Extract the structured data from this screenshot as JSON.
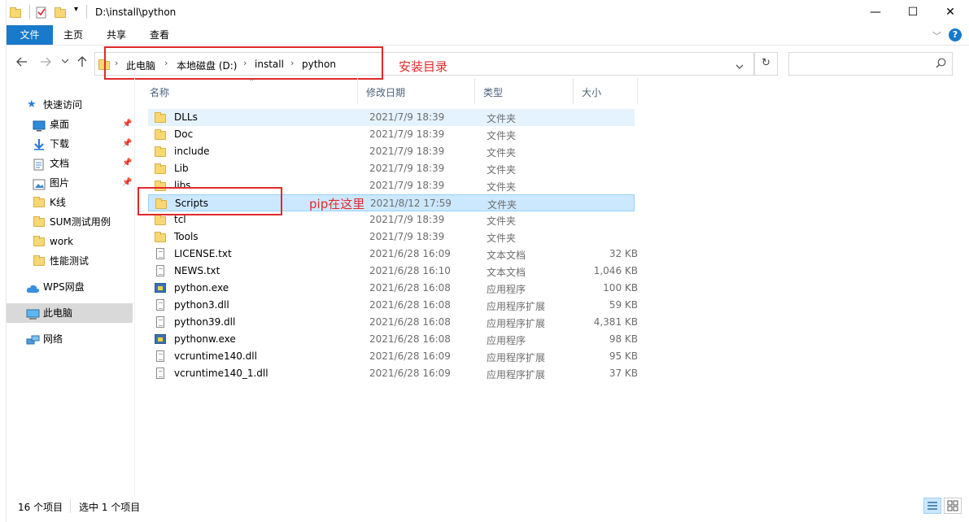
{
  "window": {
    "title": "D:\\install\\python"
  },
  "ribbon": {
    "tabs": [
      "文件",
      "主页",
      "共享",
      "查看"
    ]
  },
  "nav": {
    "back_icon": "arrow-left-icon",
    "forward_icon": "arrow-right-icon",
    "recent_icon": "chevron-down-icon",
    "up_icon": "arrow-up-icon"
  },
  "address": {
    "crumbs": [
      "此电脑",
      "本地磁盘 (D:)",
      "install",
      "python"
    ]
  },
  "annotations": {
    "address_note": "安装目录",
    "scripts_note": "pip在这里",
    "color": "#e02a2a"
  },
  "sidebar": {
    "items": [
      {
        "label": "快速访问",
        "icon": "star-icon"
      },
      {
        "label": "桌面",
        "icon": "desktop-icon",
        "pinned": true
      },
      {
        "label": "下载",
        "icon": "download-icon",
        "pinned": true
      },
      {
        "label": "文档",
        "icon": "document-icon",
        "pinned": true
      },
      {
        "label": "图片",
        "icon": "picture-icon",
        "pinned": true
      },
      {
        "label": "K线",
        "icon": "folder-icon"
      },
      {
        "label": "SUM测试用例",
        "icon": "folder-icon"
      },
      {
        "label": "work",
        "icon": "folder-icon"
      },
      {
        "label": "性能测试",
        "icon": "folder-icon"
      },
      {
        "label": "WPS网盘",
        "icon": "cloud-icon"
      },
      {
        "label": "此电脑",
        "icon": "computer-icon"
      },
      {
        "label": "网络",
        "icon": "network-icon"
      }
    ]
  },
  "columns": {
    "name": "名称",
    "modified": "修改日期",
    "type": "类型",
    "size": "大小"
  },
  "files": [
    {
      "name": "DLLs",
      "modified": "2021/7/9 18:39",
      "type": "文件夹",
      "size": "",
      "icon": "folder-icon"
    },
    {
      "name": "Doc",
      "modified": "2021/7/9 18:39",
      "type": "文件夹",
      "size": "",
      "icon": "folder-icon"
    },
    {
      "name": "include",
      "modified": "2021/7/9 18:39",
      "type": "文件夹",
      "size": "",
      "icon": "folder-icon"
    },
    {
      "name": "Lib",
      "modified": "2021/7/9 18:39",
      "type": "文件夹",
      "size": "",
      "icon": "folder-icon"
    },
    {
      "name": "libs",
      "modified": "2021/7/9 18:39",
      "type": "文件夹",
      "size": "",
      "icon": "folder-icon"
    },
    {
      "name": "Scripts",
      "modified": "2021/8/12 17:59",
      "type": "文件夹",
      "size": "",
      "icon": "folder-icon"
    },
    {
      "name": "tcl",
      "modified": "2021/7/9 18:39",
      "type": "文件夹",
      "size": "",
      "icon": "folder-icon"
    },
    {
      "name": "Tools",
      "modified": "2021/7/9 18:39",
      "type": "文件夹",
      "size": "",
      "icon": "folder-icon"
    },
    {
      "name": "LICENSE.txt",
      "modified": "2021/6/28 16:09",
      "type": "文本文档",
      "size": "32 KB",
      "icon": "text-file-icon"
    },
    {
      "name": "NEWS.txt",
      "modified": "2021/6/28 16:10",
      "type": "文本文档",
      "size": "1,046 KB",
      "icon": "text-file-icon"
    },
    {
      "name": "python.exe",
      "modified": "2021/6/28 16:08",
      "type": "应用程序",
      "size": "100 KB",
      "icon": "python-exe-icon"
    },
    {
      "name": "python3.dll",
      "modified": "2021/6/28 16:08",
      "type": "应用程序扩展",
      "size": "59 KB",
      "icon": "dll-file-icon"
    },
    {
      "name": "python39.dll",
      "modified": "2021/6/28 16:08",
      "type": "应用程序扩展",
      "size": "4,381 KB",
      "icon": "dll-file-icon"
    },
    {
      "name": "pythonw.exe",
      "modified": "2021/6/28 16:08",
      "type": "应用程序",
      "size": "98 KB",
      "icon": "python-exe-icon"
    },
    {
      "name": "vcruntime140.dll",
      "modified": "2021/6/28 16:09",
      "type": "应用程序扩展",
      "size": "95 KB",
      "icon": "dll-file-icon"
    },
    {
      "name": "vcruntime140_1.dll",
      "modified": "2021/6/28 16:09",
      "type": "应用程序扩展",
      "size": "37 KB",
      "icon": "dll-file-icon"
    }
  ],
  "status": {
    "count": "16 个项目",
    "selection": "选中 1 个项目"
  }
}
